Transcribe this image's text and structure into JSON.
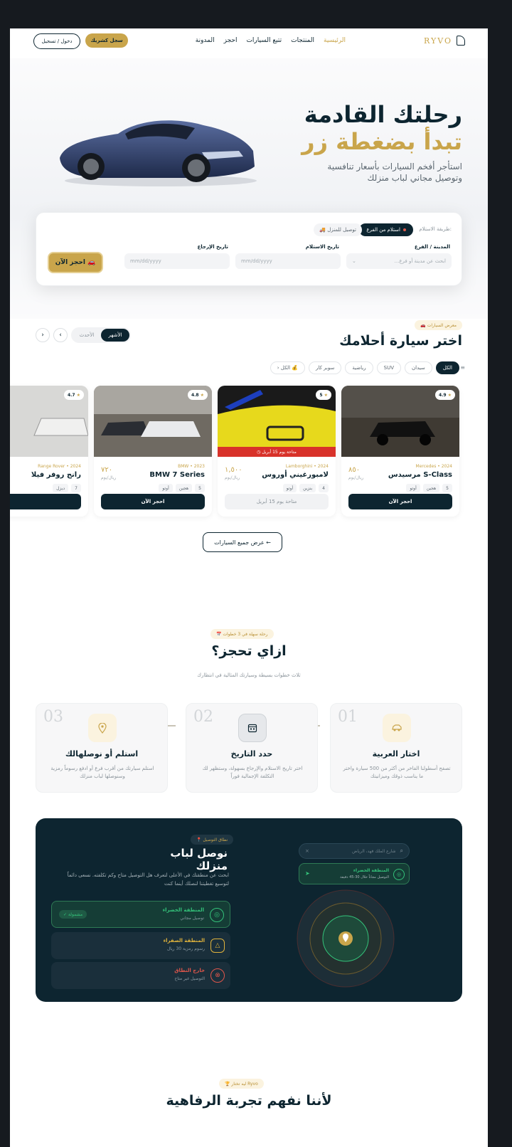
{
  "nav": {
    "logo": "RYVO",
    "links": [
      "الرئيسية",
      "المنتجات",
      "تتبع السيارات",
      "احجز",
      "المدونة"
    ],
    "active_index": 0,
    "signup": "سجل كشريك",
    "login": "دخول / تسجيل"
  },
  "hero": {
    "title_line1": "رحلتك القادمة",
    "title_line2": "تبدأ بضغطة زر",
    "subtitle": "استأجر أفخم السيارات بأسعار تنافسية وتوصيل مجاني لباب منزلك"
  },
  "booking": {
    "method_label": "طريقة الاستلام:",
    "pickup_option": "استلام من الفرع",
    "delivery_option": "🚚 توصيل للمنزل",
    "city_label": "المدينة / الفرع",
    "city_placeholder": "ابحث عن مدينة أو فرع...",
    "pickup_date_label": "تاريخ الاستلام",
    "pickup_date_placeholder": "mm/dd/yyyy",
    "return_date_label": "تاريخ الإرجاع",
    "return_date_placeholder": "mm/dd/yyyy",
    "book_button": "احجز الآن 🚗"
  },
  "gallery": {
    "badge": "🚗 معرض السيارات",
    "title": "اختر سيارة أحلامك",
    "tabs": [
      "الأشهر",
      "الأحدث"
    ],
    "filters": [
      "الكل",
      "سيدان",
      "SUV",
      "رياضية",
      "سوبر كار",
      "💰 الكل"
    ],
    "cards": [
      {
        "brand": "Mercedes • 2024",
        "name": "مرسيدس S-Class",
        "price": "٨٥٠",
        "per": "ريال/يوم",
        "rating": "4.9",
        "specs": [
          "5",
          "هجين",
          "أوتو"
        ],
        "button": "احجز الآن",
        "available": true
      },
      {
        "brand": "Lamborghini • 2024",
        "name": "لامبورغيني أوروس",
        "price": "١,٥٠٠",
        "per": "ريال/يوم",
        "rating": "5",
        "specs": [
          "4",
          "بنزين",
          "أوتو"
        ],
        "button": "متاحة يوم 15 أبريل",
        "available": false,
        "availability_banner": "متاحة يوم 15 أبريل"
      },
      {
        "brand": "BMW • 2023",
        "name": "BMW 7 Series",
        "price": "٧٢٠",
        "per": "ريال/يوم",
        "rating": "4.8",
        "specs": [
          "5",
          "هجين",
          "أوتو"
        ],
        "button": "احجز الآن",
        "available": true
      },
      {
        "brand": "Range Rover • 2024",
        "name": "رانج روفر فيلا",
        "price": "",
        "per": "",
        "rating": "4.7",
        "specs": [
          "7",
          "ديزل"
        ],
        "button": "",
        "available": true
      }
    ],
    "view_all": "عرض جميع السيارات ←"
  },
  "how": {
    "badge": "📅 رحلة سهلة في 3 خطوات",
    "title": "ازاي تحجز؟",
    "subtitle": "ثلاث خطوات بسيطة وسيارتك المثالية في انتظارك",
    "steps": [
      {
        "num": "01",
        "title": "اختار العربية",
        "desc": "تصفح أسطولنا الفاخر من أكثر من 500 سيارة واختر ما يناسب ذوقك وميزانيتك",
        "icon": "car-icon"
      },
      {
        "num": "02",
        "title": "حدد التاريخ",
        "desc": "اختر تاريخ الاستلام والإرجاع بسهولة، وستظهر لك التكلفة الإجمالية فوراً",
        "icon": "calendar-icon"
      },
      {
        "num": "03",
        "title": "استلم أو نوصلهالك",
        "desc": "استلم سيارتك من أقرب فرع أو ادفع رسوماً رمزية وسنوصلها لباب منزلك",
        "icon": "location-pin-icon"
      }
    ]
  },
  "delivery": {
    "badge": "📍 نطاق التوصيل",
    "title": "نوصل لباب منزلك",
    "desc": "ابحث عن منطقتك في الأعلى لتعرف هل التوصيل متاح وكم تكلفته. نسعى دائماً لتوسيع تغطيتنا لنصلك أينما كنت",
    "zones": [
      {
        "title": "المنطقة الخضراء",
        "sub": "توصيل مجاني",
        "tag": "✓ مشمولة",
        "color": "#34c27a"
      },
      {
        "title": "المنطقة الصفراء",
        "sub": "رسوم رمزية 30 ريال",
        "tag": "",
        "color": "#e0b33c"
      },
      {
        "title": "خارج النطاق",
        "sub": "التوصيل غير متاح",
        "tag": "",
        "color": "#e0564b"
      }
    ],
    "search_placeholder": "شارع الملك فهد، الرياض",
    "result_title": "المنطقة الخضراء",
    "result_sub": "التوصيل مجاناً خلال 30-45 دقيقة"
  },
  "why": {
    "badge": "🏆 ليه تختار Ryvo",
    "title": "لأننا نفهم تجربة الرفاهية"
  },
  "colors": {
    "navy": "#0d2530",
    "gold": "#c9a54b"
  }
}
